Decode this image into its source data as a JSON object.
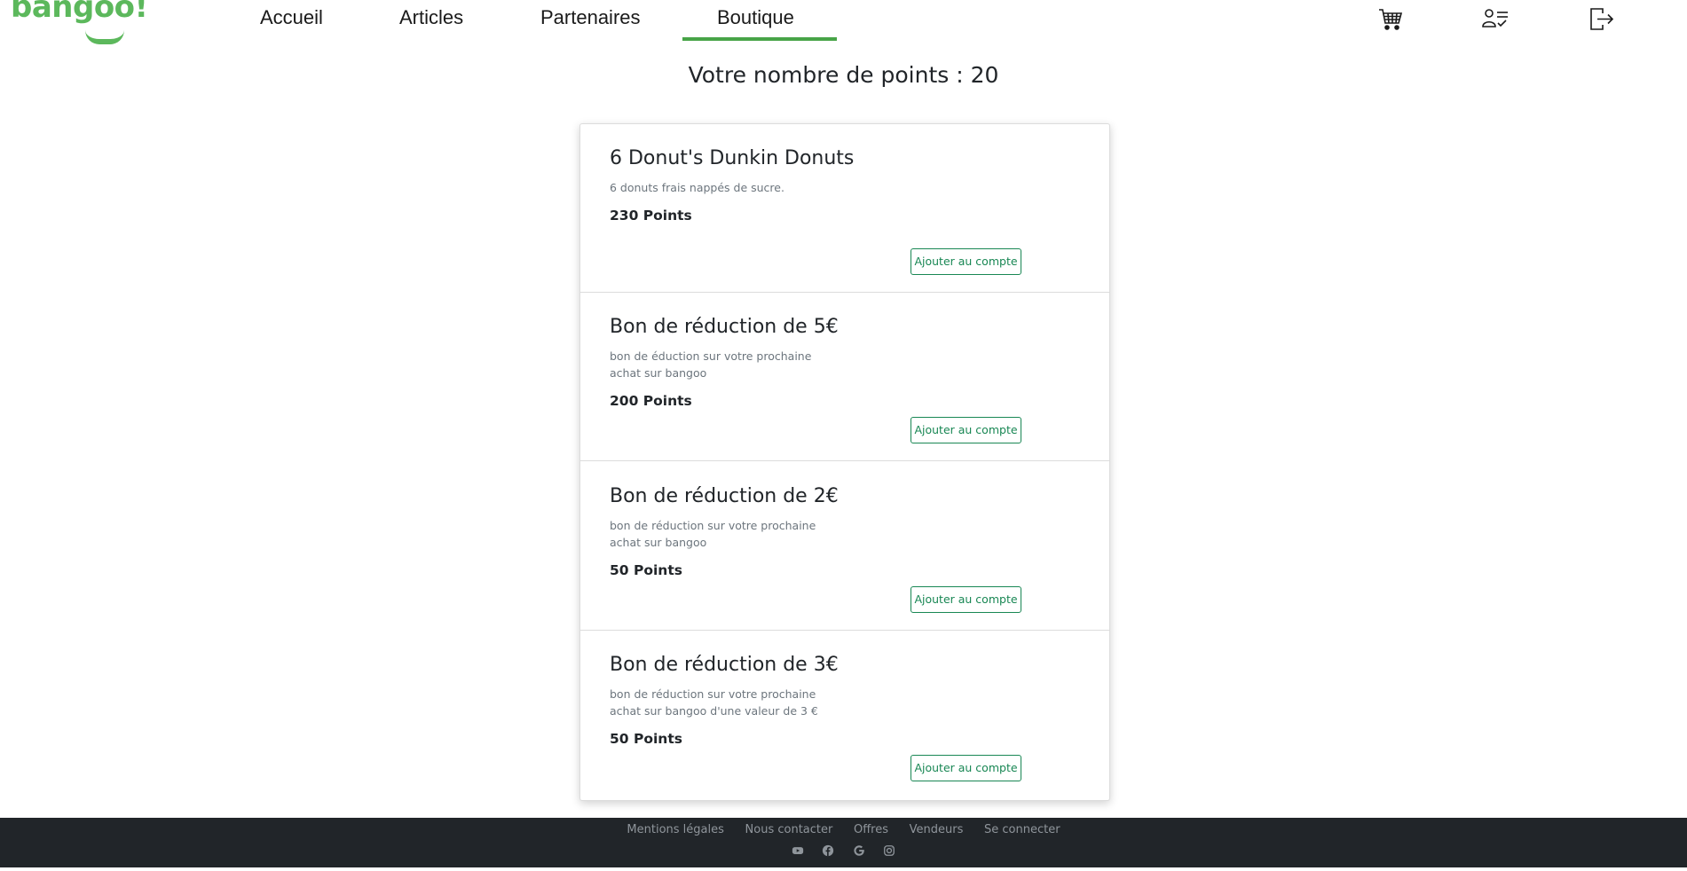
{
  "header": {
    "logo_text": "bangoo!",
    "nav": [
      {
        "label": "Accueil"
      },
      {
        "label": "Articles"
      },
      {
        "label": "Partenaires"
      },
      {
        "label": "Boutique",
        "active": true
      }
    ],
    "icons": [
      "cart-icon",
      "user-list-icon",
      "logout-icon"
    ]
  },
  "points": {
    "text": "Votre nombre de points : 20"
  },
  "products": [
    {
      "title": "6 Donut's Dunkin Donuts",
      "description": "6 donuts frais nappés de sucre.",
      "points": "230 Points",
      "button": "Ajouter au compte"
    },
    {
      "title": "Bon de réduction de 5€",
      "description": "bon de éduction sur votre prochaine achat sur bangoo",
      "points": "200 Points",
      "button": "Ajouter au compte"
    },
    {
      "title": "Bon de réduction de 2€",
      "description": "bon de réduction sur votre prochaine achat sur bangoo",
      "points": "50 Points",
      "button": "Ajouter au compte"
    },
    {
      "title": "Bon de réduction de 3€",
      "description": "bon de réduction sur votre prochaine achat sur bangoo d'une valeur de 3 €",
      "points": "50 Points",
      "button": "Ajouter au compte"
    }
  ],
  "footer": {
    "links": [
      "Mentions légales",
      "Nous contacter",
      "Offres",
      "Vendeurs",
      "Se connecter"
    ],
    "social_icons": [
      "youtube-icon",
      "facebook-icon",
      "google-icon",
      "instagram-icon"
    ]
  },
  "colors": {
    "brand_green": "#5cb85c",
    "nav_underline": "#47a447",
    "button_green": "#198754",
    "footer_bg": "#212529"
  }
}
